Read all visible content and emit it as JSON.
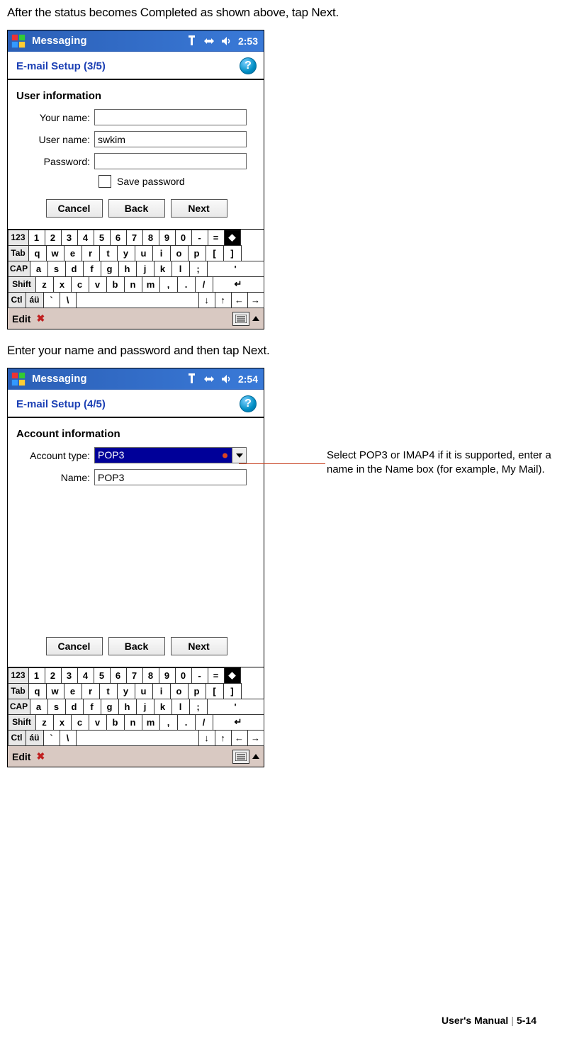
{
  "instructions": {
    "line1": "After the status becomes Completed as shown above, tap Next.",
    "line2": "Enter your name and password and then tap Next."
  },
  "annotation": "Select POP3 or IMAP4 if it is supported, enter a name in the Name box (for example, My Mail).",
  "screen1": {
    "titlebar_app": "Messaging",
    "time": "2:53",
    "subtitle": "E-mail Setup (3/5)",
    "section": "User information",
    "fields": {
      "your_name_label": "Your name:",
      "your_name_value": "",
      "user_name_label": "User name:",
      "user_name_value": "swkim",
      "password_label": "Password:",
      "password_value": "",
      "save_password_label": "Save password"
    },
    "buttons": {
      "cancel": "Cancel",
      "back": "Back",
      "next": "Next"
    },
    "toolbar_edit": "Edit"
  },
  "screen2": {
    "titlebar_app": "Messaging",
    "time": "2:54",
    "subtitle": "E-mail Setup (4/5)",
    "section": "Account information",
    "fields": {
      "account_type_label": "Account type:",
      "account_type_value": "POP3",
      "name_label": "Name:",
      "name_value": "POP3"
    },
    "buttons": {
      "cancel": "Cancel",
      "back": "Back",
      "next": "Next"
    },
    "toolbar_edit": "Edit"
  },
  "keyboard": {
    "row1": [
      "123",
      "1",
      "2",
      "3",
      "4",
      "5",
      "6",
      "7",
      "8",
      "9",
      "0",
      "-",
      "=",
      "◆"
    ],
    "row2": [
      "Tab",
      "q",
      "w",
      "e",
      "r",
      "t",
      "y",
      "u",
      "i",
      "o",
      "p",
      "[",
      "]"
    ],
    "row3": [
      "CAP",
      "a",
      "s",
      "d",
      "f",
      "g",
      "h",
      "j",
      "k",
      "l",
      ";",
      "'"
    ],
    "row4": [
      "Shift",
      "z",
      "x",
      "c",
      "v",
      "b",
      "n",
      "m",
      ",",
      ".",
      "/",
      "↵"
    ],
    "row5": [
      "Ctl",
      "áü",
      "`",
      "\\",
      " ",
      "↓",
      "↑",
      "←",
      "→"
    ]
  },
  "footer": {
    "manual": "User's Manual",
    "page": "5-14"
  }
}
